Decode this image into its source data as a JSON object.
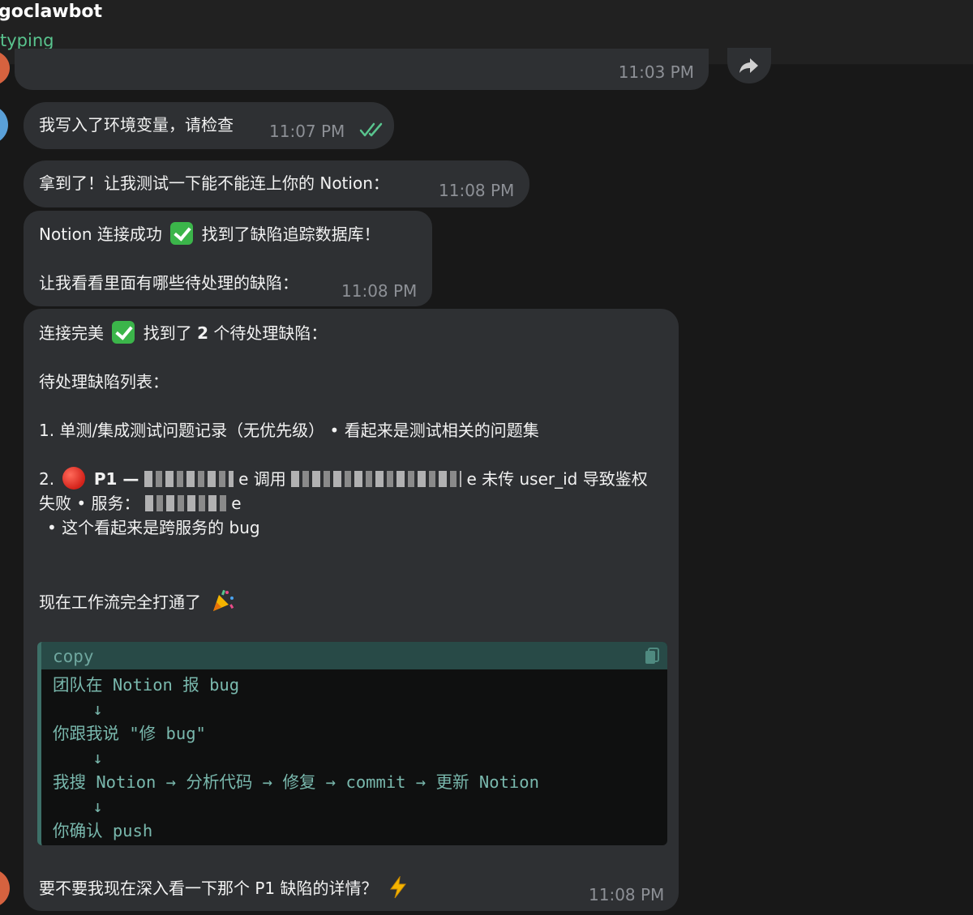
{
  "header": {
    "title": "goclawbot",
    "status": "typing"
  },
  "messages": {
    "m0": {
      "time": "11:03 PM"
    },
    "m1": {
      "text": "我写入了环境变量，请检查",
      "time": "11:07 PM",
      "status": "read"
    },
    "m2": {
      "text": "拿到了！让我测试一下能不能连上你的 Notion：",
      "time": "11:08 PM"
    },
    "m3": {
      "line1_a": "Notion 连接成功",
      "line1_b": "找到了缺陷追踪数据库！",
      "line2": "让我看看里面有哪些待处理的缺陷：",
      "time": "11:08 PM"
    },
    "m4": {
      "l1_a": "连接完美",
      "l1_b": "找到了",
      "l1_count": "2",
      "l1_c": "个待处理缺陷：",
      "l2": "待处理缺陷列表：",
      "item1": "1. 单测/集成测试问题记录（无优先级） • 看起来是测试相关的问题集",
      "item2_num": "2.",
      "item2_priority": "P1 —",
      "item2_tail_a": "e 调用",
      "item2_tail_b": "e 未传 user_id 导致鉴权",
      "item2_line2_a": "失败 • 服务：",
      "item2_line2_b": "e",
      "item2_line3": "• 这个看起来是跨服务的 bug",
      "summary": "现在工作流完全打通了",
      "code": {
        "lang": "copy",
        "lines": [
          "团队在 Notion 报 bug",
          "    ↓",
          "你跟我说 \"修 bug\"",
          "    ↓",
          "我搜 Notion → 分析代码 → 修复 → commit → 更新 Notion",
          "    ↓",
          "你确认 push"
        ]
      },
      "question": "要不要我现在深入看一下那个 P1 缺陷的详情？",
      "time": "11:08 PM"
    }
  },
  "colors": {
    "background": "#181818",
    "bubble": "#2e3033",
    "accent_green": "#59c48e",
    "code_text": "#79b8ad"
  }
}
